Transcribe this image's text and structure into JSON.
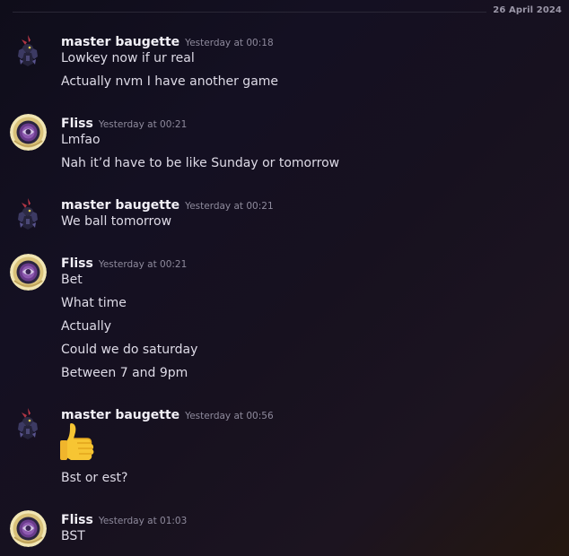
{
  "divider": {
    "date": "26 April 2024"
  },
  "messages": [
    {
      "author": "master baugette",
      "timestamp": "Yesterday at 00:18",
      "lines": [
        "Lowkey now if ur real",
        "Actually nvm I have another game"
      ]
    },
    {
      "author": "Fliss",
      "timestamp": "Yesterday at 00:21",
      "lines": [
        "Lmfao",
        "Nah it’d have to be like Sunday or tomorrow"
      ]
    },
    {
      "author": "master baugette",
      "timestamp": "Yesterday at 00:21",
      "lines": [
        "We ball tomorrow"
      ]
    },
    {
      "author": "Fliss",
      "timestamp": "Yesterday at 00:21",
      "lines": [
        "Bet",
        "What time",
        "Actually",
        "Could we do saturday",
        "Between 7 and 9pm"
      ]
    },
    {
      "author": "master baugette",
      "timestamp": "Yesterday at 00:56",
      "emoji": "thumbs-up-emoji",
      "lines": [
        "Bst or est?"
      ]
    },
    {
      "author": "Fliss",
      "timestamp": "Yesterday at 01:03",
      "lines": [
        "BST"
      ]
    }
  ],
  "avatars": {
    "master_baugette": "dark-creature-avatar-icon",
    "fliss": "orb-ball-avatar-icon"
  }
}
